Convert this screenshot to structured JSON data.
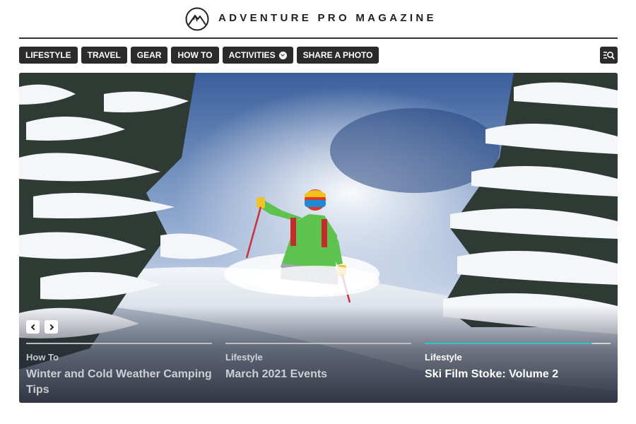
{
  "brand": {
    "name": "ADVENTURE PRO MAGAZINE"
  },
  "nav": {
    "items": [
      {
        "label": "LIFESTYLE",
        "icon": null
      },
      {
        "label": "TRAVEL",
        "icon": null
      },
      {
        "label": "GEAR",
        "icon": null
      },
      {
        "label": "HOW TO",
        "icon": null
      },
      {
        "label": "ACTIVITIES",
        "icon": "chevron-down-icon"
      },
      {
        "label": "SHARE A PHOTO",
        "icon": null
      }
    ],
    "search_icon": "search-menu-icon"
  },
  "hero": {
    "image": "backcountry skier in green jacket and red helmet skiing through powder among snow-covered pine trees",
    "prev_icon": "chevron-left-icon",
    "next_icon": "chevron-right-icon",
    "slides": [
      {
        "category": "How To",
        "title": "Winter and Cold Weather Camping Tips",
        "active": false
      },
      {
        "category": "Lifestyle",
        "title": "March 2021 Events",
        "active": false
      },
      {
        "category": "Lifestyle",
        "title": "Ski Film Stoke: Volume 2",
        "active": true
      }
    ]
  },
  "colors": {
    "nav_bg": "#2b2b2b",
    "accent": "#2ec4c9",
    "text": "#1f1f1f"
  }
}
